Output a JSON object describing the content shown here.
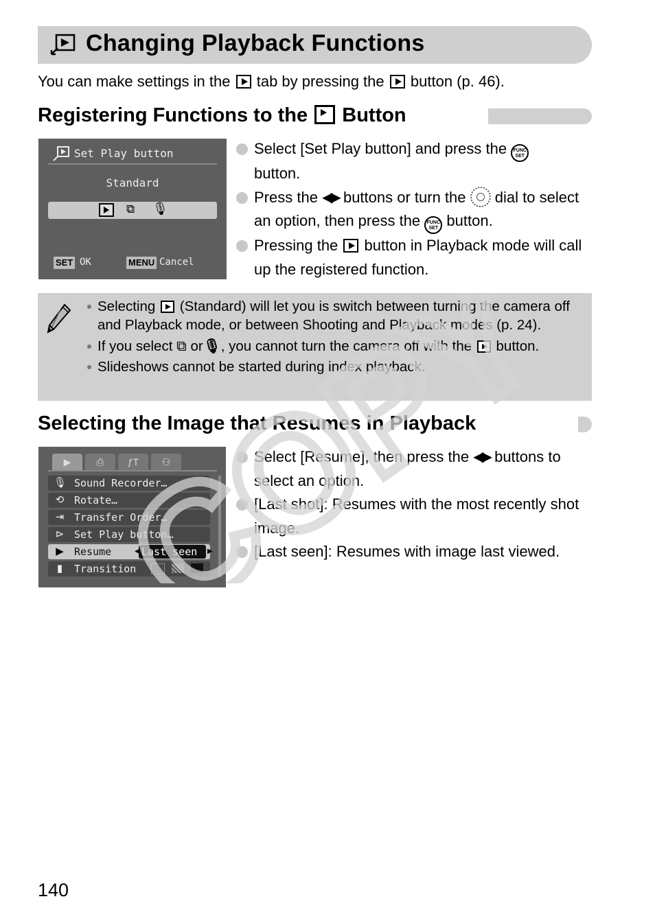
{
  "page": {
    "title": "Changing Playback Functions",
    "intro": {
      "part1": "You can make settings in the",
      "part2": "tab by pressing the",
      "part3": "button (p. 46)."
    },
    "page_number": "140"
  },
  "section1": {
    "heading_part1": "Registering Functions to the",
    "heading_part2": "Button",
    "screen": {
      "title": "Set Play button",
      "selected_label": "Standard",
      "options": [
        "playback-icon",
        "slideshow-icon",
        "sound-recorder-icon"
      ],
      "footer_left_key": "SET",
      "footer_left_label": "OK",
      "footer_right_key": "MENU",
      "footer_right_label": "Cancel"
    },
    "steps": {
      "s1_a": "Select [Set Play button] and press the",
      "s1_b": "button.",
      "s2_a": "Press the",
      "s2_b": "buttons or turn the",
      "s2_c": "dial to select an option, then press the",
      "s2_d": "button.",
      "s3_a": "Pressing the",
      "s3_b": "button in Playback mode will call up the registered function."
    },
    "func_label_top": "FUNC",
    "func_label_bottom": "SET",
    "arrows": "◀▶"
  },
  "notes": {
    "n1_a": "Selecting",
    "n1_b": "(Standard) will let you is switch between turning the camera off and Playback mode, or between Shooting and Playback modes (p. 24).",
    "n2_a": "If you select",
    "n2_b": "or",
    "n2_c": ", you cannot turn the camera off with the",
    "n2_d": "button.",
    "n3": "Slideshows cannot be started during index playback."
  },
  "section2": {
    "heading": "Selecting the Image that Resumes in Playback",
    "screen": {
      "tabs": [
        "playback-tab",
        "print-tab",
        "setup-tab",
        "my-camera-tab"
      ],
      "menu_items": [
        {
          "icon": "microphone-icon",
          "label": "Sound Recorder…"
        },
        {
          "icon": "rotate-icon",
          "label": "Rotate…"
        },
        {
          "icon": "transfer-icon",
          "label": "Transfer Order…"
        },
        {
          "icon": "set-play-icon",
          "label": "Set Play button…"
        },
        {
          "icon": "resume-icon",
          "label": "Resume",
          "value": "Last seen",
          "selected": true
        },
        {
          "icon": "transition-icon",
          "label": "Transition"
        }
      ]
    },
    "steps": {
      "s1_a": "Select [Resume], then press the",
      "s1_b": "buttons to select an option.",
      "s2": "[Last shot]: Resumes with the most recently shot image.",
      "s3": "[Last seen]: Resumes with image last viewed."
    },
    "arrows": "◀▶"
  },
  "watermark": "COPY",
  "colors": {
    "panel_gray": "#d0d0d0",
    "screen_bg": "#5e5e5e",
    "watermark": "#d4d4d4"
  }
}
